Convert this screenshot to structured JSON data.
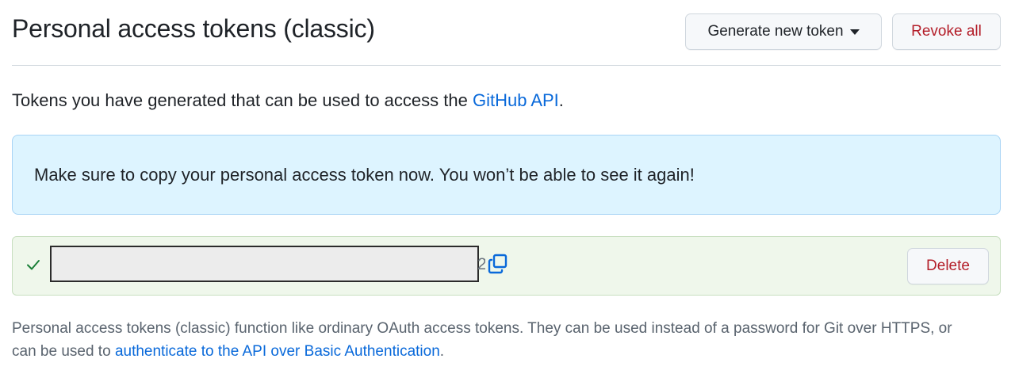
{
  "header": {
    "title": "Personal access tokens (classic)",
    "generate_label": "Generate new token",
    "revoke_label": "Revoke all"
  },
  "intro": {
    "text_before": "Tokens you have generated that can be used to access the ",
    "link_text": "GitHub API",
    "text_after": "."
  },
  "flash": {
    "message": "Make sure to copy your personal access token now. You won’t be able to see it again!"
  },
  "token_row": {
    "check_icon": "check-icon",
    "token_value_visible_tail": "2",
    "copy_icon": "copy-icon",
    "delete_label": "Delete"
  },
  "note": {
    "text_before": "Personal access tokens (classic) function like ordinary OAuth access tokens. They can be used instead of a password for Git over HTTPS, or can be used to ",
    "link_text": "authenticate to the API over Basic Authentication",
    "text_after": "."
  },
  "colors": {
    "link": "#0969da",
    "danger": "#b31d28",
    "flash_bg": "#ddf4ff",
    "success_bg": "#eff7eb",
    "success_icon": "#1a7f37"
  }
}
